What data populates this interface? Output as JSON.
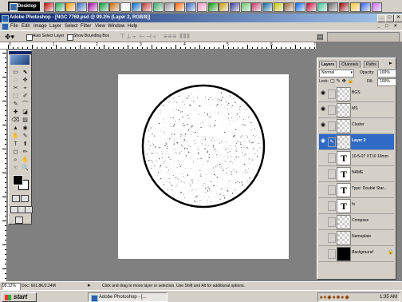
{
  "desktop_bar": {
    "button_label": "Desktop"
  },
  "window": {
    "title": "Adobe Photoshop - [NGC 7769.psd @ 99.2% (Layer 2, RGB/8)]"
  },
  "menu": [
    "File",
    "Edit",
    "Image",
    "Layer",
    "Select",
    "Filter",
    "View",
    "Window",
    "Help"
  ],
  "options": {
    "auto_select": "Auto Select Layer",
    "bounding_box": "Show Bounding Box"
  },
  "ruler_labels": [
    "0",
    "1",
    "2",
    "3",
    "4",
    "5",
    "6",
    "7"
  ],
  "layers_panel": {
    "tabs": [
      "Layers",
      "Channels",
      "Paths"
    ],
    "blend_mode": "Normal",
    "opacity_label": "Opacity:",
    "opacity_value": "100%",
    "lock_label": "Lock:",
    "fill_label": "Fill:",
    "fill_value": "100%",
    "layers": [
      {
        "name": "BGS",
        "type": "raster",
        "visible": true,
        "selected": false
      },
      {
        "name": "MS",
        "type": "raster",
        "visible": true,
        "selected": false
      },
      {
        "name": "Cluster",
        "type": "raster",
        "visible": true,
        "selected": false
      },
      {
        "name": "Layer 2",
        "type": "raster",
        "visible": true,
        "selected": true
      },
      {
        "name": "10-5-07 XT10 16mm",
        "type": "text",
        "visible": false,
        "selected": false
      },
      {
        "name": "NAME",
        "type": "text",
        "visible": false,
        "selected": false
      },
      {
        "name": "Type: Double Star...",
        "type": "text",
        "visible": false,
        "selected": false
      },
      {
        "name": "hi",
        "type": "text",
        "visible": false,
        "selected": false
      },
      {
        "name": "Compass",
        "type": "raster",
        "visible": false,
        "selected": false
      },
      {
        "name": "Nameplate",
        "type": "raster",
        "visible": false,
        "selected": false
      },
      {
        "name": "Background",
        "type": "background",
        "visible": false,
        "selected": false
      }
    ]
  },
  "status": {
    "zoom": "99.12%",
    "doc": "Doc: 601.8K/2.24M",
    "hint": "Click and drag to move layer or selection.  Use Shift and Alt for additional options."
  },
  "taskbar": {
    "start_label": "start",
    "task_label": "Adobe Photoshop - [...",
    "clock": "1:35 AM"
  }
}
